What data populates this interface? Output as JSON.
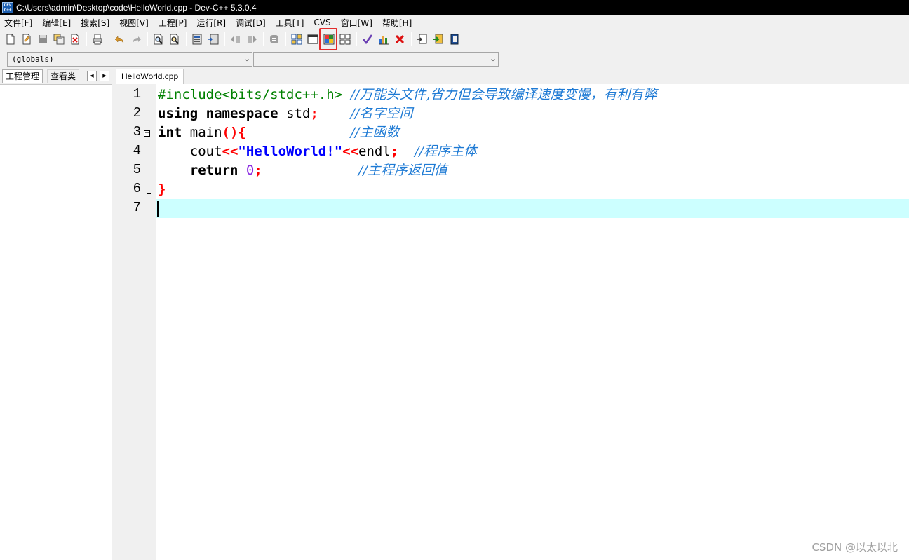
{
  "window": {
    "title": "C:\\Users\\admin\\Desktop\\code\\HelloWorld.cpp - Dev-C++ 5.3.0.4",
    "app_icon_text": "DEV C++"
  },
  "menu": [
    {
      "label": "文件[F]"
    },
    {
      "label": "编辑[E]"
    },
    {
      "label": "搜索[S]"
    },
    {
      "label": "视图[V]"
    },
    {
      "label": "工程[P]"
    },
    {
      "label": "运行[R]"
    },
    {
      "label": "调试[D]"
    },
    {
      "label": "工具[T]"
    },
    {
      "label": "CVS"
    },
    {
      "label": "窗口[W]"
    },
    {
      "label": "帮助[H]"
    }
  ],
  "toolbar": {
    "highlighted_button": "toggle-fullscreen",
    "highlight_color": "#e32b2b"
  },
  "scope_combo": {
    "value": "(globals)",
    "second_value": ""
  },
  "left_panel": {
    "tabs": [
      {
        "label": "工程管理"
      },
      {
        "label": "查看类"
      }
    ]
  },
  "editor": {
    "file_tab": "HelloWorld.cpp",
    "line_numbers": [
      "1",
      "2",
      "3",
      "4",
      "5",
      "6",
      "7"
    ],
    "lines": [
      {
        "pre": "#include<bits/stdc++.h>",
        "comment": "//万能头文件,省力但会导致编译速度变慢，有利有弊"
      },
      {
        "kw1": "using",
        "kw2": "namespace",
        "id": "std",
        "semi": ";",
        "comment": "//名字空间"
      },
      {
        "kw": "int",
        "id": "main",
        "paren": "(){",
        "comment": "//主函数"
      },
      {
        "id1": "cout",
        "op1": "<<",
        "str": "\"HelloWorld!\"",
        "op2": "<<",
        "id2": "endl",
        "semi": ";",
        "comment": "//程序主体"
      },
      {
        "kw": "return",
        "num": "0",
        "semi": ";",
        "comment": "//主程序返回值"
      },
      {
        "brace": "}"
      },
      {}
    ],
    "colors": {
      "active_line": "#ccffff",
      "comment": "#1e7ad4",
      "preprocessor": "#008000",
      "string": "#0000ff",
      "operator": "#ff0000",
      "number": "#8a2be2"
    }
  },
  "watermark": "CSDN @以太以北"
}
